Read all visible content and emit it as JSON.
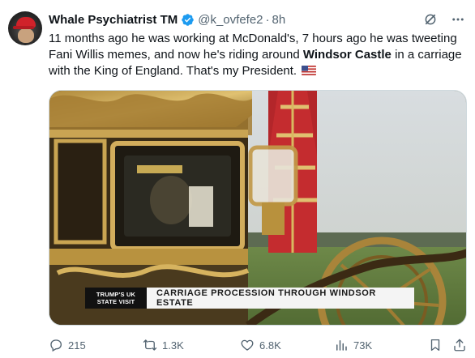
{
  "tweet": {
    "display_name": "Whale Psychiatrist",
    "name_suffix": "TM",
    "handle": "@k_ovfefe2",
    "separator": "·",
    "time": "8h",
    "text_part1": "11 months ago he was working at McDonald's, 7 hours ago he was tweeting Fani Willis memes, and now he's riding around ",
    "text_bold": "Windsor Castle",
    "text_part2": " in a carriage with the King of England. That's my President.",
    "flag_icon": "us-flag-icon"
  },
  "media": {
    "banner_tag": "TRUMP'S UK STATE VISIT",
    "banner_text": "CARRIAGE PROCESSION THROUGH WINDSOR ESTATE"
  },
  "actions": {
    "replies": "215",
    "reposts": "1.3K",
    "likes": "6.8K",
    "views": "73K"
  },
  "colors": {
    "text": "#0f1419",
    "muted": "#536471",
    "verified": "#1d9bf0"
  }
}
